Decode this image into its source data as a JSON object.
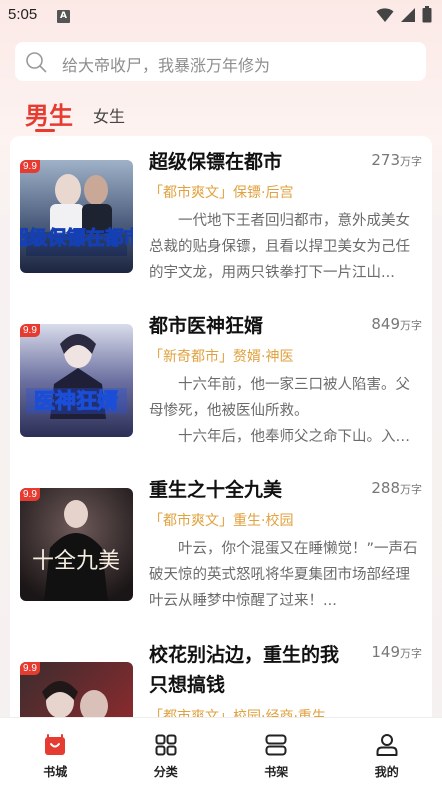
{
  "status_bar": {
    "time": "5:05",
    "notification_icon": "A"
  },
  "search": {
    "placeholder": "给大帝收尸，我暴涨万年修为"
  },
  "tabs": [
    {
      "label": "男生",
      "active": true
    },
    {
      "label": "女生",
      "active": false
    }
  ],
  "books": [
    {
      "title": "超级保镖在都市",
      "title_line2": "",
      "count": "273",
      "unit": "万字",
      "badge": "9.9",
      "tags": "「都市爽文」保镖·后宫",
      "desc": [
        "一代地下王者回归都市，意外成美女总裁的贴身保镖，且看以捍卫美女为己任的宇文龙，用两只铁拳打下一片江山..."
      ],
      "cover_text": "超级保镖在都市"
    },
    {
      "title": "都市医神狂婿",
      "title_line2": "",
      "count": "849",
      "unit": "万字",
      "badge": "9.9",
      "tags": "「新奇都市」赘婿·神医",
      "desc": [
        "十六年前，他一家三口被人陷害。父母惨死，他被医仙所救。",
        "十六年后，他奉师父之命下山。入赘豪门..."
      ],
      "cover_text": "医神狂婿"
    },
    {
      "title": "重生之十全九美",
      "title_line2": "",
      "count": "288",
      "unit": "万字",
      "badge": "9.9",
      "tags": "「都市爽文」重生·校园",
      "desc": [
        "叶云，你个混蛋又在睡懒觉！”一声石破天惊的英式怒吼将华夏集团市场部经理叶云从睡梦中惊醒了过来！..."
      ],
      "cover_text": "十全九美"
    },
    {
      "title": "校花别沾边，重生的我",
      "title_line2": "只想搞钱",
      "count": "149",
      "unit": "万字",
      "badge": "9.9",
      "tags": "「都市爽文」校园·经商·重生",
      "desc": [],
      "cover_text": ""
    }
  ],
  "bottom_nav": [
    {
      "label": "书城",
      "icon": "bookstore-icon",
      "active": true
    },
    {
      "label": "分类",
      "icon": "category-icon",
      "active": false
    },
    {
      "label": "书架",
      "icon": "bookshelf-icon",
      "active": false
    },
    {
      "label": "我的",
      "icon": "profile-icon",
      "active": false
    }
  ],
  "colors": {
    "accent": "#e53b31",
    "tag": "#e0a23f"
  }
}
